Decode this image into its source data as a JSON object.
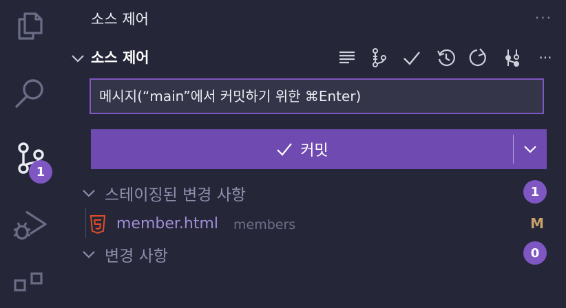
{
  "activity_bar": {
    "icons": [
      "files-icon",
      "search-icon",
      "source-control-icon",
      "run-debug-icon",
      "extensions-icon"
    ],
    "source_control_badge": "1",
    "badge_color": "#7e57c2"
  },
  "view": {
    "title": "소스 제어",
    "more_label": "···"
  },
  "section": {
    "title": "소스 제어",
    "toolbar_icons": [
      "view-as-tree-icon",
      "branch-graph-icon",
      "commit-check-icon",
      "history-icon",
      "refresh-icon",
      "source-control-graph-icon",
      "more-icon"
    ],
    "more_label": "···"
  },
  "commit": {
    "placeholder": "메시지(“main”에서 커밋하기 위한 ⌘Enter)",
    "button_label": "커밋",
    "button_color": "#6f4ab0"
  },
  "staged": {
    "label": "스테이징된 변경 사항",
    "count": "1",
    "files": [
      {
        "name": "member.html",
        "dir": "members",
        "status": "M"
      }
    ]
  },
  "changes": {
    "label": "변경 사항",
    "count": "0"
  }
}
